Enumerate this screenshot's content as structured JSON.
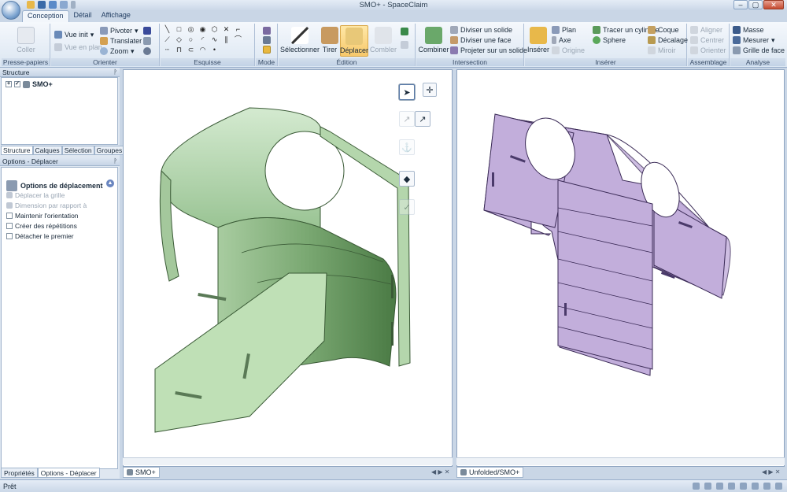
{
  "window": {
    "title": "SMO+ - SpaceClaim"
  },
  "tabs": [
    "Conception",
    "Détail",
    "Affichage"
  ],
  "groups": {
    "clipboard": "Presse-papiers",
    "orient": "Orienter",
    "sketch": "Esquisse",
    "mode": "Mode",
    "edit": "Édition",
    "intersect": "Intersection",
    "insert": "Insérer",
    "assembly": "Assemblage",
    "analysis": "Analyse"
  },
  "clipboard": {
    "paste": "Coller"
  },
  "orient": {
    "home": "Vue init",
    "plan": "Vue en plan",
    "pivot": "Pivoter",
    "translate": "Translater",
    "zoom": "Zoom"
  },
  "edit": {
    "select": "Sélectionner",
    "pull": "Tirer",
    "move": "Déplacer",
    "fill": "Combler"
  },
  "intersect": {
    "combine": "Combiner",
    "split_body": "Diviser un solide",
    "split_face": "Diviser une face",
    "project": "Projeter sur un solide"
  },
  "insert": {
    "insert": "Insérer",
    "plane": "Plan",
    "axis": "Axe",
    "origin": "Origine",
    "cylinder": "Tracer un cylindre",
    "sphere": "Sphere",
    "shell": "Coque",
    "offset": "Décalage",
    "mirror": "Miroir"
  },
  "assembly": {
    "align": "Aligner",
    "center": "Centrer",
    "orient": "Orienter"
  },
  "analysis": {
    "mass": "Masse",
    "measure": "Mesurer",
    "face_grid": "Grille de face"
  },
  "structure": {
    "title": "Structure",
    "root": "SMO+",
    "tabs": [
      "Structure",
      "Calques",
      "Sélection",
      "Groupes"
    ]
  },
  "options": {
    "header": "Options - Déplacer",
    "section": "Options de déplacement",
    "move_grid": "Déplacer la grille",
    "dimension": "Dimension par rapport à",
    "items": [
      "Maintenir l'orientation",
      "Créer des répétitions",
      "Détacher le premier"
    ]
  },
  "bottom_tabs": [
    "Propriétés",
    "Options - Déplacer"
  ],
  "docs": {
    "left": "SMO+",
    "right": "Unfolded/SMO+"
  },
  "status": {
    "text": "Prêt"
  },
  "colors": {
    "part_green": "#aed4a6",
    "part_purple": "#bfa8d6",
    "ribbon_bg": "#dbe6f2",
    "selected": "#f7c86a"
  }
}
